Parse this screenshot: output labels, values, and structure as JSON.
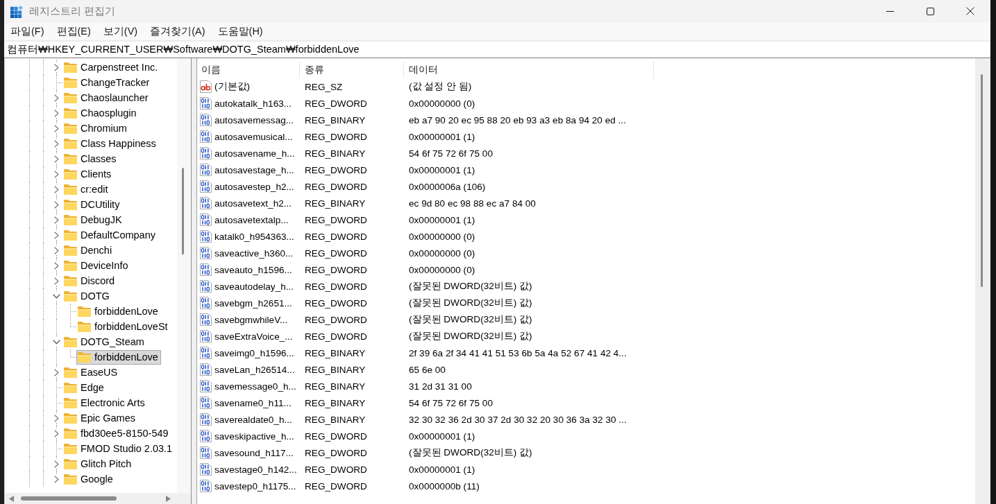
{
  "window": {
    "title": "레지스트리 편집기"
  },
  "menu": [
    "파일(F)",
    "편집(E)",
    "보기(V)",
    "즐겨찾기(A)",
    "도움말(H)"
  ],
  "address": {
    "value": "컴퓨터₩HKEY_CURRENT_USER₩Software₩DOTG_Steam₩forbiddenLove"
  },
  "tree": {
    "items": [
      {
        "label": "Carpenstreet Inc.",
        "kind": "branch",
        "expanded": false,
        "selected": false
      },
      {
        "label": "ChangeTracker",
        "kind": "leaf",
        "selected": false
      },
      {
        "label": "Chaoslauncher",
        "kind": "branch",
        "expanded": false,
        "selected": false
      },
      {
        "label": "Chaosplugin",
        "kind": "branch",
        "expanded": false,
        "selected": false
      },
      {
        "label": "Chromium",
        "kind": "branch",
        "expanded": false,
        "selected": false
      },
      {
        "label": "Class Happiness",
        "kind": "branch",
        "expanded": false,
        "selected": false
      },
      {
        "label": "Classes",
        "kind": "branch",
        "expanded": false,
        "selected": false
      },
      {
        "label": "Clients",
        "kind": "branch",
        "expanded": false,
        "selected": false
      },
      {
        "label": "cr:edit",
        "kind": "branch",
        "expanded": false,
        "selected": false
      },
      {
        "label": "DCUtility",
        "kind": "branch",
        "expanded": false,
        "selected": false
      },
      {
        "label": "DebugJK",
        "kind": "branch",
        "expanded": false,
        "selected": false
      },
      {
        "label": "DefaultCompany",
        "kind": "branch",
        "expanded": false,
        "selected": false
      },
      {
        "label": "Denchi",
        "kind": "branch",
        "expanded": false,
        "selected": false
      },
      {
        "label": "DeviceInfo",
        "kind": "branch",
        "expanded": false,
        "selected": false
      },
      {
        "label": "Discord",
        "kind": "branch",
        "expanded": false,
        "selected": false
      },
      {
        "label": "DOTG",
        "kind": "branch",
        "expanded": true,
        "selected": false,
        "children": [
          {
            "label": "forbiddenLove",
            "kind": "leaf",
            "selected": false
          },
          {
            "label": "forbiddenLoveSt",
            "kind": "leaf",
            "selected": false
          }
        ]
      },
      {
        "label": "DOTG_Steam",
        "kind": "branch",
        "expanded": true,
        "selected": false,
        "children": [
          {
            "label": "forbiddenLove",
            "kind": "leaf",
            "selected": true
          }
        ]
      },
      {
        "label": "EaseUS",
        "kind": "branch",
        "expanded": false,
        "selected": false
      },
      {
        "label": "Edge",
        "kind": "leaf",
        "selected": false
      },
      {
        "label": "Electronic Arts",
        "kind": "leaf",
        "selected": false
      },
      {
        "label": "Epic Games",
        "kind": "branch",
        "expanded": false,
        "selected": false
      },
      {
        "label": "fbd30ee5-8150-549",
        "kind": "branch",
        "expanded": false,
        "selected": false
      },
      {
        "label": "FMOD Studio 2.03.1",
        "kind": "leaf",
        "selected": false
      },
      {
        "label": "Glitch Pitch",
        "kind": "branch",
        "expanded": false,
        "selected": false
      },
      {
        "label": "Google",
        "kind": "branch",
        "expanded": false,
        "selected": false
      }
    ]
  },
  "values": {
    "columns": [
      "이름",
      "종류",
      "데이터"
    ],
    "rows": [
      {
        "kind": "string",
        "name": "(기본값)",
        "type": "REG_SZ",
        "data": "(값 설정 안 됨)"
      },
      {
        "kind": "binary",
        "name": "autokatalk_h163...",
        "type": "REG_DWORD",
        "data": "0x00000000 (0)"
      },
      {
        "kind": "binary",
        "name": "autosavemessag...",
        "type": "REG_BINARY",
        "data": "eb a7 90 20 ec 95 88 20 eb 93 a3 eb 8a 94 20 ed ..."
      },
      {
        "kind": "binary",
        "name": "autosavemusical...",
        "type": "REG_DWORD",
        "data": "0x00000001 (1)"
      },
      {
        "kind": "binary",
        "name": "autosavename_h...",
        "type": "REG_BINARY",
        "data": "54 6f 75 72 6f 75 00"
      },
      {
        "kind": "binary",
        "name": "autosavestage_h...",
        "type": "REG_DWORD",
        "data": "0x00000001 (1)"
      },
      {
        "kind": "binary",
        "name": "autosavestep_h2...",
        "type": "REG_DWORD",
        "data": "0x0000006a (106)"
      },
      {
        "kind": "binary",
        "name": "autosavetext_h2...",
        "type": "REG_BINARY",
        "data": "ec 9d 80 ec 98 88 ec a7 84 00"
      },
      {
        "kind": "binary",
        "name": "autosavetextalp...",
        "type": "REG_DWORD",
        "data": "0x00000001 (1)"
      },
      {
        "kind": "binary",
        "name": "katalk0_h954363...",
        "type": "REG_DWORD",
        "data": "0x00000000 (0)"
      },
      {
        "kind": "binary",
        "name": "saveactive_h360...",
        "type": "REG_DWORD",
        "data": "0x00000000 (0)"
      },
      {
        "kind": "binary",
        "name": "saveauto_h1596...",
        "type": "REG_DWORD",
        "data": "0x00000000 (0)"
      },
      {
        "kind": "binary",
        "name": "saveautodelay_h...",
        "type": "REG_DWORD",
        "data": "(잘못된 DWORD(32비트) 값)"
      },
      {
        "kind": "binary",
        "name": "savebgm_h2651...",
        "type": "REG_DWORD",
        "data": "(잘못된 DWORD(32비트) 값)"
      },
      {
        "kind": "binary",
        "name": "savebgmwhileV...",
        "type": "REG_DWORD",
        "data": "(잘못된 DWORD(32비트) 값)"
      },
      {
        "kind": "binary",
        "name": "saveExtraVoice_...",
        "type": "REG_DWORD",
        "data": "(잘못된 DWORD(32비트) 값)"
      },
      {
        "kind": "binary",
        "name": "saveimg0_h1596...",
        "type": "REG_BINARY",
        "data": "2f 39 6a 2f 34 41 41 51 53 6b 5a 4a 52 67 41 42 4..."
      },
      {
        "kind": "binary",
        "name": "saveLan_h26514...",
        "type": "REG_BINARY",
        "data": "65 6e 00"
      },
      {
        "kind": "binary",
        "name": "savemessage0_h...",
        "type": "REG_BINARY",
        "data": "31 2d 31 31 00"
      },
      {
        "kind": "binary",
        "name": "savename0_h11...",
        "type": "REG_BINARY",
        "data": "54 6f 75 72 6f 75 00"
      },
      {
        "kind": "binary",
        "name": "saverealdate0_h...",
        "type": "REG_BINARY",
        "data": "32 30 32 36 2d 30 37 2d 30 32 20 30 36 3a 32 30 ..."
      },
      {
        "kind": "binary",
        "name": "saveskipactive_h...",
        "type": "REG_DWORD",
        "data": "0x00000001 (1)"
      },
      {
        "kind": "binary",
        "name": "savesound_h117...",
        "type": "REG_DWORD",
        "data": "(잘못된 DWORD(32비트) 값)"
      },
      {
        "kind": "binary",
        "name": "savestage0_h142...",
        "type": "REG_DWORD",
        "data": "0x00000001 (1)"
      },
      {
        "kind": "binary",
        "name": "savestep0_h1175...",
        "type": "REG_DWORD",
        "data": "0x0000000b (11)"
      }
    ]
  }
}
